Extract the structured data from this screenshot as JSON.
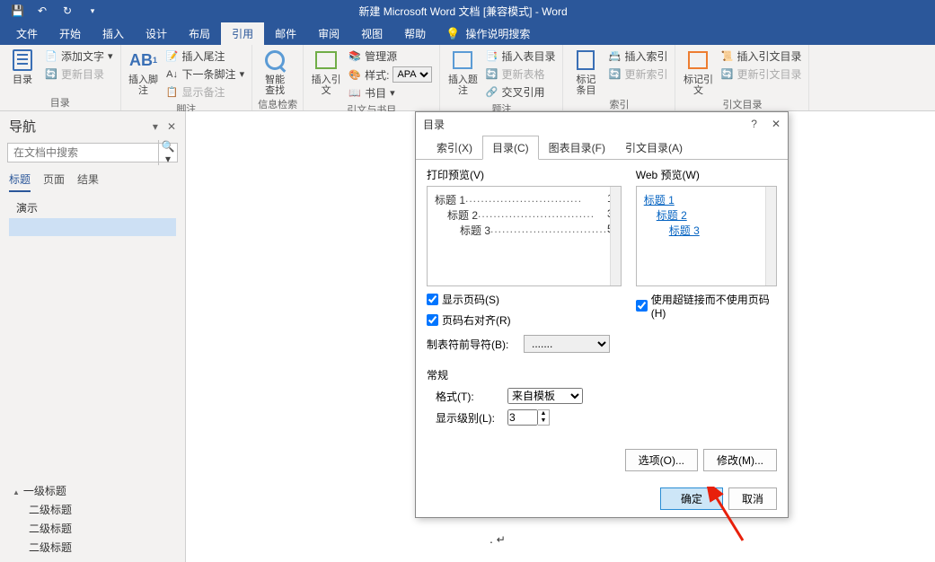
{
  "title": "新建 Microsoft Word 文档 [兼容模式]  -  Word",
  "tabs": {
    "file": "文件",
    "home": "开始",
    "insert": "插入",
    "design": "设计",
    "layout": "布局",
    "references": "引用",
    "mailings": "邮件",
    "review": "审阅",
    "view": "视图",
    "help": "帮助",
    "tell": "操作说明搜索"
  },
  "ribbon": {
    "toc": {
      "btn": "目录",
      "add_text": "添加文字",
      "update": "更新目录",
      "group": "目录"
    },
    "footnote": {
      "btn": "插入脚注",
      "endnote": "插入尾注",
      "next": "下一条脚注",
      "show": "显示备注",
      "group": "脚注"
    },
    "research": {
      "btn": "智能\n查找",
      "group": "信息检索"
    },
    "citation": {
      "btn": "插入引文",
      "manage": "管理源",
      "style_label": "样式:",
      "style_value": "APA",
      "biblio": "书目",
      "group": "引文与书目"
    },
    "caption": {
      "btn": "插入题注",
      "table": "插入表目录",
      "update": "更新表格",
      "cross": "交叉引用",
      "group": "题注"
    },
    "index": {
      "btn": "标记\n条目",
      "insert": "插入索引",
      "update": "更新索引",
      "group": "索引"
    },
    "authorities": {
      "btn": "标记引文",
      "insert": "插入引文目录",
      "update": "更新引文目录",
      "group": "引文目录"
    }
  },
  "nav": {
    "title": "导航",
    "search_placeholder": "在文档中搜索",
    "tabs": {
      "headings": "标题",
      "pages": "页面",
      "results": "结果"
    },
    "demo": "演示",
    "outline": {
      "l1": "一级标题",
      "l2a": "二级标题",
      "l2b": "二级标题",
      "l2c": "二级标题"
    }
  },
  "dialog": {
    "title": "目录",
    "tabs": {
      "index": "索引(X)",
      "toc": "目录(C)",
      "figures": "图表目录(F)",
      "authorities": "引文目录(A)"
    },
    "print_preview": "打印预览(V)",
    "web_preview": "Web 预览(W)",
    "print_lines": [
      {
        "label": "标题  1",
        "page": "1"
      },
      {
        "label": "标题  2",
        "page": "3",
        "indent": 1
      },
      {
        "label": "标题  3",
        "page": "5",
        "indent": 2
      }
    ],
    "web_lines": [
      "标题  1",
      "标题  2",
      "标题  3"
    ],
    "show_page": "显示页码(S)",
    "right_align": "页码右对齐(R)",
    "leader_label": "制表符前导符(B):",
    "leader_value": ".......",
    "use_hyperlinks": "使用超链接而不使用页码(H)",
    "general": "常规",
    "format_label": "格式(T):",
    "format_value": "来自模板",
    "levels_label": "显示级别(L):",
    "levels_value": "3",
    "options": "选项(O)...",
    "modify": "修改(M)...",
    "ok": "确定",
    "cancel": "取消"
  },
  "doc_cursor": "↵"
}
